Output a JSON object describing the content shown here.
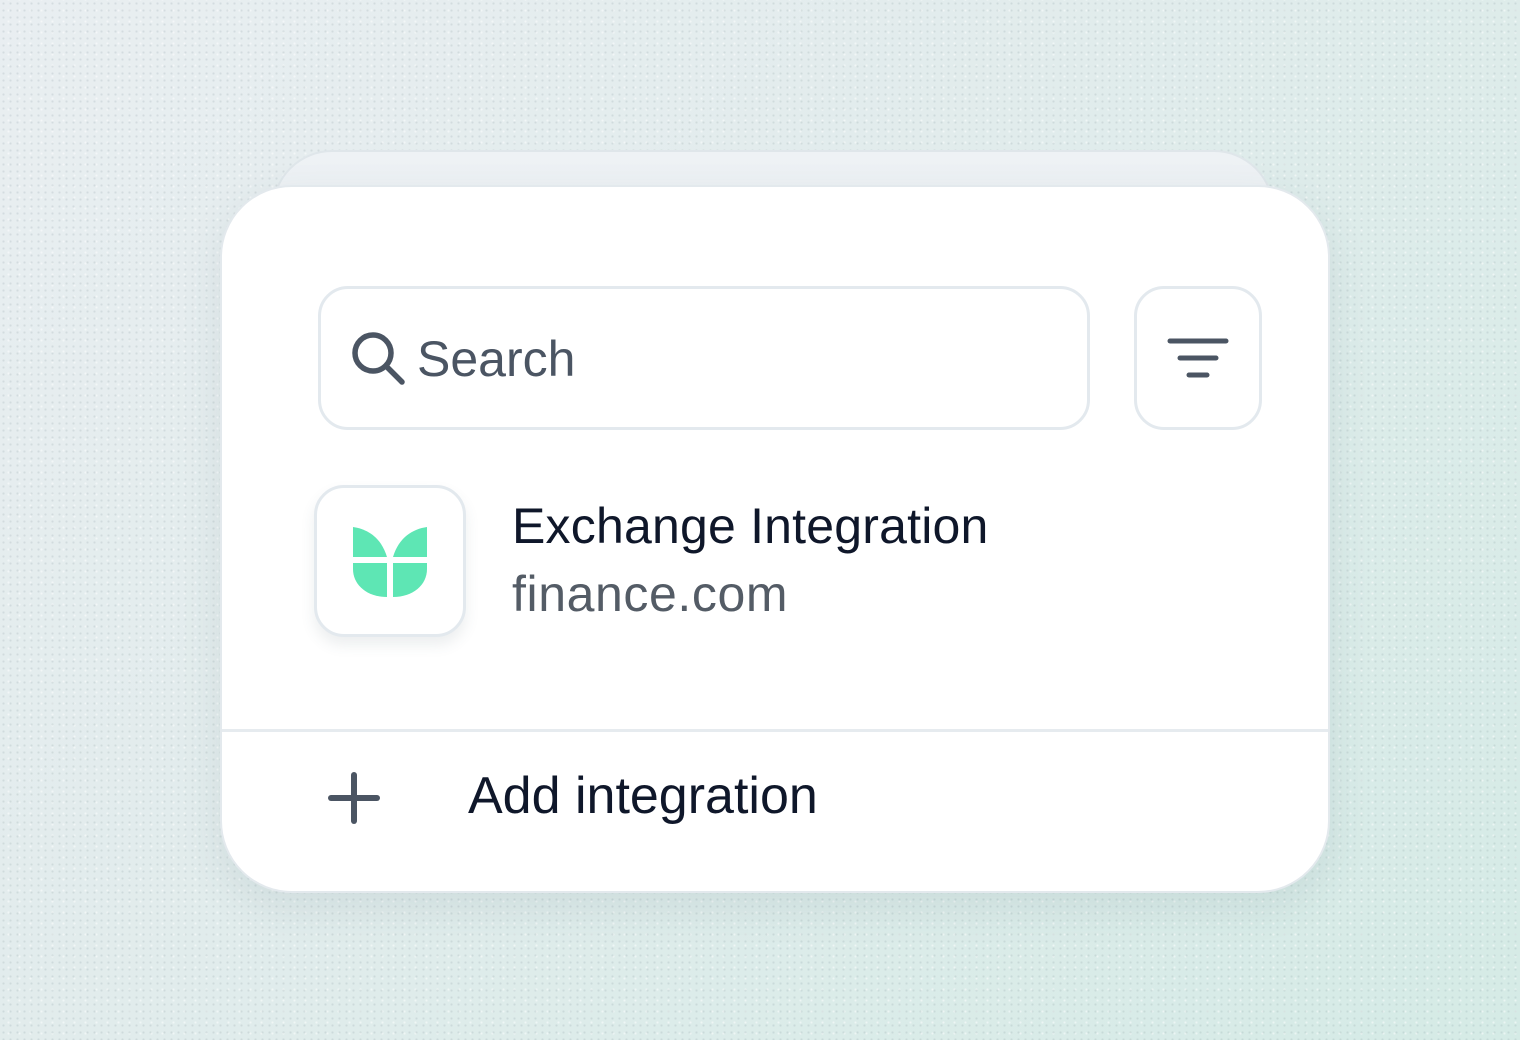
{
  "search": {
    "placeholder": "Search",
    "value": "",
    "icon": "search-icon"
  },
  "filter": {
    "icon": "filter-icon"
  },
  "integrations": [
    {
      "name": "Exchange Integration",
      "domain": "finance.com",
      "icon": "leaf-logo-icon",
      "logo_color": "#5ee6b4"
    }
  ],
  "add_integration": {
    "label": "Add integration",
    "icon": "plus-icon"
  },
  "colors": {
    "text_primary": "#0f172a",
    "text_secondary": "#545c66",
    "border": "#e3e9ee",
    "accent": "#5ee6b4"
  }
}
